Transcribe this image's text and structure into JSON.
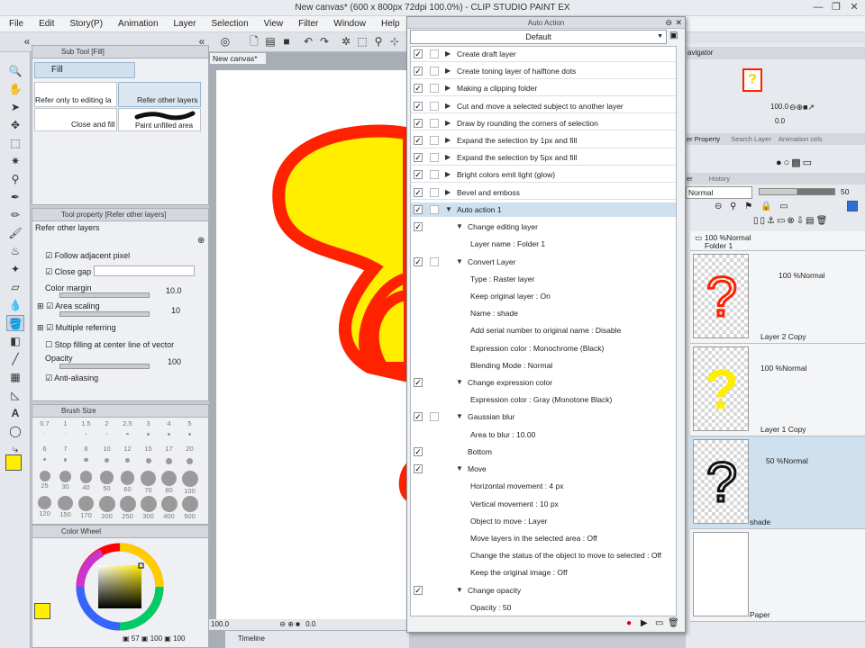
{
  "window": {
    "title": "New canvas* (600 x 800px 72dpi 100.0%) - CLIP STUDIO PAINT EX"
  },
  "menu": [
    "File",
    "Edit",
    "Story(P)",
    "Animation",
    "Layer",
    "Selection",
    "View",
    "Filter",
    "Window",
    "Help"
  ],
  "canvas_tab": "New canvas*",
  "sub_tool": {
    "header": "Sub Tool [Fill]",
    "group": "Fill",
    "items": [
      "Refer only to editing la",
      "Refer other layers",
      "Close and fill",
      "Paint unfilled area"
    ]
  },
  "tool_property": {
    "header": "Tool property [Refer other layers]",
    "name": "Refer other layers",
    "follow_adjacent": "Follow adjacent pixel",
    "close_gap": "Close gap",
    "color_margin_label": "Color margin",
    "color_margin_value": "10.0",
    "area_scaling_label": "Area scaling",
    "area_scaling_value": "10",
    "multiple_referring": "Multiple referring",
    "stop_filling": "Stop filling at center line of vector",
    "opacity_label": "Opacity",
    "opacity_value": "100",
    "anti_aliasing": "Anti-aliasing"
  },
  "brush_size": {
    "header": "Brush Size",
    "row1": [
      "0.7",
      "1",
      "1.5",
      "2",
      "2.5",
      "3",
      "4",
      "5"
    ],
    "row2": [
      "6",
      "7",
      "8",
      "10",
      "12",
      "15",
      "17",
      "20"
    ],
    "row3": [
      "25",
      "30",
      "40",
      "50",
      "60",
      "70",
      "80",
      "100"
    ],
    "row4": [
      "120",
      "150",
      "170",
      "200",
      "250",
      "300",
      "400",
      "500"
    ]
  },
  "color_wheel": {
    "header": "Color Wheel",
    "values": [
      "57",
      "100",
      "100"
    ]
  },
  "colors": {
    "main": "#ffee00",
    "red": "#ff2200",
    "accent": "#2d6fd6"
  },
  "bottom_bar": {
    "zoom": "100.0",
    "zoom2": "0.0",
    "timeline": "Timeline"
  },
  "auto_action": {
    "title": "Auto Action",
    "set": "Default",
    "rows": [
      {
        "label": "Create draft layer",
        "type": "action",
        "checked": true
      },
      {
        "label": "Create toning layer of halftone dots",
        "type": "action",
        "checked": true
      },
      {
        "label": "Making a clipping folder",
        "type": "action",
        "checked": true
      },
      {
        "label": "Cut and move a selected subject to another layer",
        "type": "action",
        "checked": true
      },
      {
        "label": "Draw by rounding the corners of selection",
        "type": "action",
        "checked": true
      },
      {
        "label": "Expand the selection by 1px and fill",
        "type": "action",
        "checked": true
      },
      {
        "label": "Expand the selection by 5px and fill",
        "type": "action",
        "checked": true
      },
      {
        "label": "Bright colors emit light (glow)",
        "type": "action",
        "checked": true
      },
      {
        "label": "Bevel and emboss",
        "type": "action",
        "checked": true
      },
      {
        "label": "Auto action 1",
        "type": "open",
        "checked": true
      },
      {
        "label": "Change editing layer",
        "type": "step",
        "checked": true
      },
      {
        "label": "Layer name : Folder 1",
        "type": "param"
      },
      {
        "label": "Convert Layer",
        "type": "step",
        "checked": true,
        "box": true
      },
      {
        "label": "Type : Raster layer",
        "type": "param"
      },
      {
        "label": "Keep original layer : On",
        "type": "param"
      },
      {
        "label": "Name : shade",
        "type": "param"
      },
      {
        "label": "Add serial number to original name : Disable",
        "type": "param"
      },
      {
        "label": "Expression color : Monochrome (Black)",
        "type": "param"
      },
      {
        "label": "Blending Mode : Normal",
        "type": "param"
      },
      {
        "label": "Change expression color",
        "type": "step",
        "checked": true
      },
      {
        "label": "Expression color : Gray (Monotone Black)",
        "type": "param"
      },
      {
        "label": "Gaussian blur",
        "type": "step",
        "checked": true,
        "box": true
      },
      {
        "label": "Area to blur : 10.00",
        "type": "param"
      },
      {
        "label": "Bottom",
        "type": "plain",
        "checked": true
      },
      {
        "label": "Move",
        "type": "step",
        "checked": true
      },
      {
        "label": "Horizontal movement : 4 px",
        "type": "param"
      },
      {
        "label": "Vertical movement : 10 px",
        "type": "param"
      },
      {
        "label": "Object to move : Layer",
        "type": "param"
      },
      {
        "label": "Move layers in the selected area : Off",
        "type": "param"
      },
      {
        "label": "Change the status of the object to move to selected : Off",
        "type": "param"
      },
      {
        "label": "Keep the original image : Off",
        "type": "param"
      },
      {
        "label": "Change opacity",
        "type": "step",
        "checked": true
      },
      {
        "label": "Opacity : 50",
        "type": "param"
      }
    ]
  },
  "right_tabs": {
    "navigator": "avigator",
    "layer_property": "er Property",
    "search_layer": "Search Layer",
    "animation_cels": "Animation cels",
    "history": "History"
  },
  "layer_panel": {
    "blend": "Normal",
    "opacity": "50",
    "nav_zoom": "100.0",
    "nav_angle": "0.0",
    "folder": {
      "mode": "100 %Normal",
      "name": "Folder 1"
    },
    "layers": [
      {
        "mode": "100 %Normal",
        "name": "Layer 2 Copy"
      },
      {
        "mode": "100 %Normal",
        "name": "Layer 1 Copy"
      },
      {
        "mode": "50 %Normal",
        "name": "shade"
      },
      {
        "mode": "",
        "name": "Paper"
      }
    ]
  }
}
